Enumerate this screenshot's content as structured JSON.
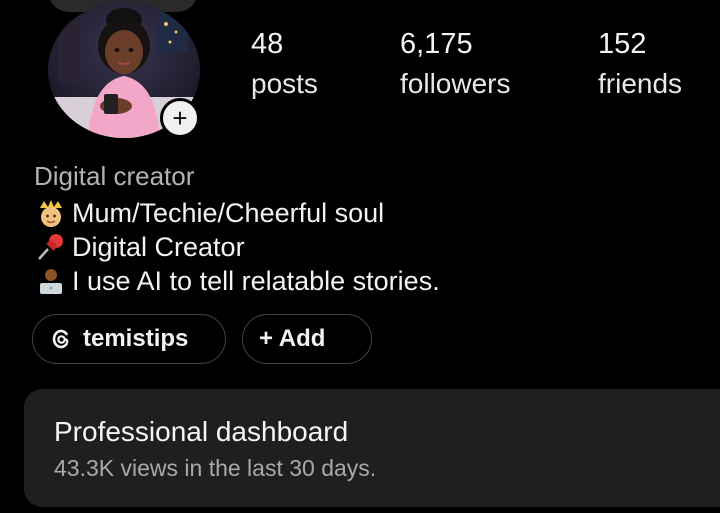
{
  "profile": {
    "stats": [
      {
        "value": "48",
        "label": "posts"
      },
      {
        "value": "6,175",
        "label": "followers"
      },
      {
        "value": "152",
        "label": "friends"
      }
    ],
    "category": "Digital creator",
    "bio": [
      {
        "icon": "queen-emoji-icon",
        "text": "Mum/Techie/Cheerful soul"
      },
      {
        "icon": "pushpin-emoji-icon",
        "text": " Digital Creator"
      },
      {
        "icon": "technologist-emoji-icon",
        "text": " I use AI to tell relatable stories."
      }
    ],
    "links": {
      "threads_handle": "temistips",
      "add_label": "+ Add"
    }
  },
  "dashboard": {
    "title": "Professional dashboard",
    "subtitle": "43.3K views in the last 30 days."
  },
  "colors": {
    "background": "#000000",
    "card": "#1f1f1f",
    "muted_text": "#a9a9a9"
  }
}
